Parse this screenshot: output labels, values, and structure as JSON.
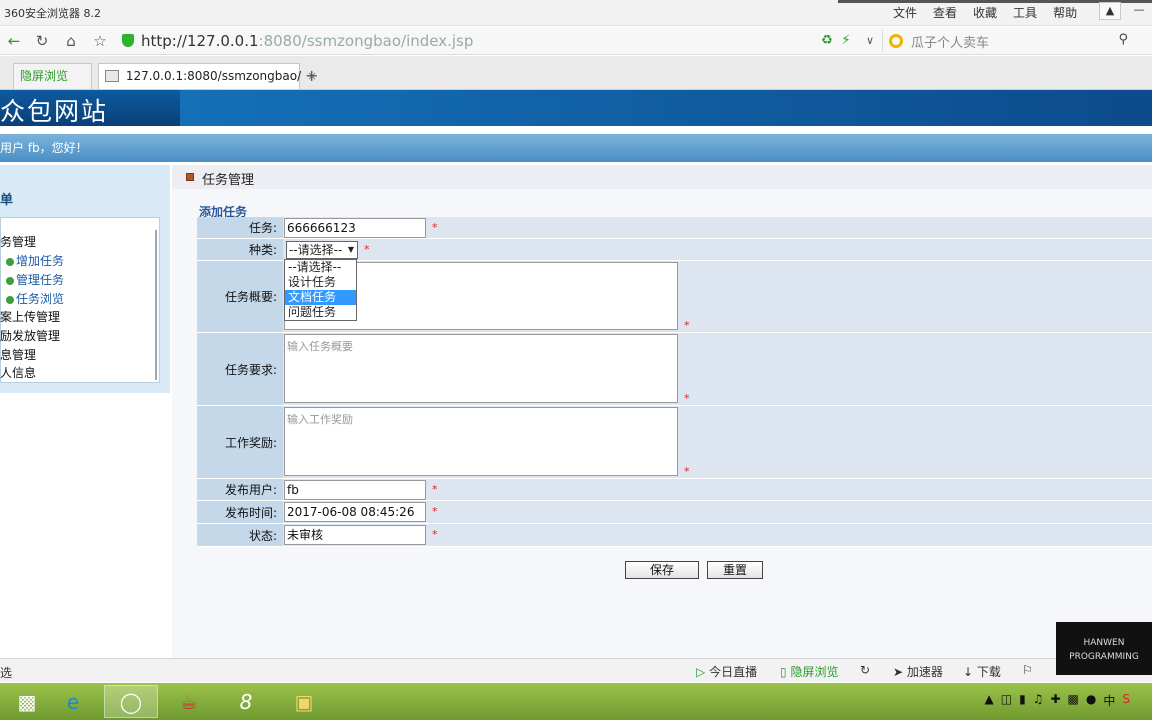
{
  "browser": {
    "app_title": "360安全浏览器 8.2",
    "menu": [
      "文件",
      "查看",
      "收藏",
      "工具",
      "帮助"
    ],
    "url_host": "http://127.0.0.1",
    "url_rest": ":8080/ssmzongbao/index.jsp",
    "search_placeholder": "瓜子个人卖车",
    "tabs": [
      {
        "label": "隐屏浏览"
      },
      {
        "label": "127.0.0.1:8080/ssmzongbao/"
      }
    ],
    "tab_close": "×",
    "new_tab": "+",
    "status_text": "选",
    "status_items": [
      "今日直播",
      "隐屏浏览",
      "加速器",
      "下载"
    ]
  },
  "site": {
    "logo": "众包网站",
    "welcome": "用户 fb，您好！"
  },
  "sidebar": {
    "title": "单",
    "items": [
      {
        "label": "务管理",
        "sub": false
      },
      {
        "label": "增加任务",
        "sub": true
      },
      {
        "label": "管理任务",
        "sub": true
      },
      {
        "label": "任务浏览",
        "sub": true
      },
      {
        "label": "案上传管理",
        "sub": false
      },
      {
        "label": "励发放管理",
        "sub": false
      },
      {
        "label": "息管理",
        "sub": false
      },
      {
        "label": "人信息",
        "sub": false
      }
    ]
  },
  "main": {
    "heading": "任务管理",
    "form_title": "添加任务",
    "fields": {
      "task": {
        "label": "任务:",
        "value": "666666123"
      },
      "category": {
        "label": "种类:",
        "value": "--请选择--",
        "options": [
          "--请选择--",
          "设计任务",
          "文档任务",
          "问题任务"
        ],
        "highlighted": "文档任务"
      },
      "summary": {
        "label": "任务概要:",
        "placeholder": ""
      },
      "requirement": {
        "label": "任务要求:",
        "placeholder": "输入任务概要"
      },
      "reward": {
        "label": "工作奖励:",
        "placeholder": "输入工作奖励"
      },
      "publisher": {
        "label": "发布用户:",
        "value": "fb"
      },
      "time": {
        "label": "发布时间:",
        "value": "2017-06-08 08:45:26"
      },
      "status": {
        "label": "状态:",
        "value": "未审核"
      }
    },
    "required_mark": "*",
    "save_label": "保存",
    "reset_label": "重置"
  },
  "watermark": "HANWEN PROGRAMMING"
}
